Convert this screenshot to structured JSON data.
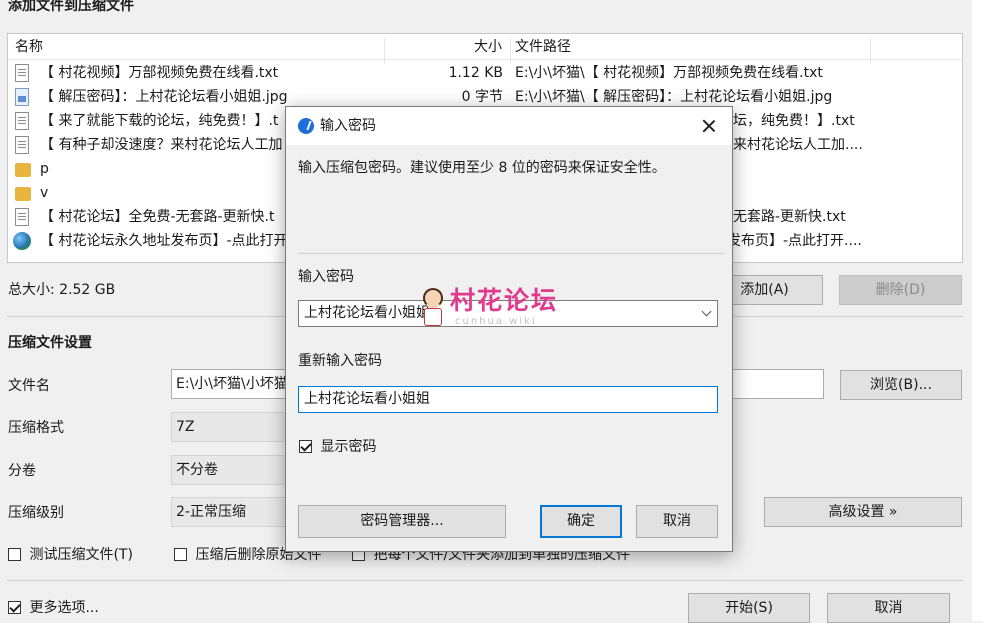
{
  "window": {
    "title": "添加文件到压缩文件"
  },
  "file_list": {
    "headers": {
      "name": "名称",
      "size": "大小",
      "path": "文件路径"
    },
    "rows": [
      {
        "icon": "text-file-icon",
        "name": "【 村花视频】万部视频免费在线看.txt",
        "size": "1.12 KB",
        "path": "E:\\小\\坏猫\\【 村花视频】万部视频免费在线看.txt"
      },
      {
        "icon": "image-file-icon",
        "name": "【 解压密码】：上村花论坛看小姐姐.jpg",
        "size": "0 字节",
        "path": "E:\\小\\坏猫\\【 解压密码】：上村花论坛看小姐姐.jpg"
      },
      {
        "icon": "text-file-icon",
        "name": "【 来了就能下载的论坛，纯免费！】.t",
        "size": "",
        "path": "坛，纯免费！】.txt"
      },
      {
        "icon": "text-file-icon",
        "name": "【 有种子却没速度？来村花论坛人工加",
        "size": "",
        "path": "来村花论坛人工加...."
      },
      {
        "icon": "folder-icon",
        "name": "p",
        "size": "",
        "path": ""
      },
      {
        "icon": "folder-icon",
        "name": "v",
        "size": "",
        "path": ""
      },
      {
        "icon": "text-file-icon",
        "name": "【 村花论坛】全免费-无套路-更新快.t",
        "size": "",
        "path": "无套路-更新快.txt"
      },
      {
        "icon": "globe-icon",
        "name": "【 村花论坛永久地址发布页】-点此打开",
        "size": "",
        "path": "发布页】-点此打开...."
      }
    ]
  },
  "total_size": "总大小: 2.52 GB",
  "buttons": {
    "add": "添加(A)",
    "remove": "删除(D)",
    "browse": "浏览(B)...",
    "advanced": "高级设置 »",
    "start": "开始(S)",
    "cancel": "取消"
  },
  "settings": {
    "section_title": "压缩文件设置",
    "filename_label": "文件名",
    "filename_value": "E:\\小\\坏猫\\小坏猫",
    "format_label": "压缩格式",
    "format_value": "7Z",
    "split_label": "分卷",
    "split_value": "不分卷",
    "level_label": "压缩级别",
    "level_value": "2-正常压缩",
    "test_label": "测试压缩文件(T)",
    "delete_label": "压缩后删除原始文件",
    "each_label": "把每个文件/文件夹添加到单独的压缩文件",
    "more_label": "更多选项..."
  },
  "dialog": {
    "title": "输入密码",
    "description": "输入压缩包密码。建议使用至少 8 位的密码来保证安全性。",
    "password_label": "输入密码",
    "password_value": "上村花论坛看小姐姐",
    "reenter_label": "重新输入密码",
    "reenter_value": "上村花论坛看小姐姐",
    "show_password_label": "显示密码",
    "show_password_checked": true,
    "manager_button": "密码管理器...",
    "ok_button": "确定",
    "cancel_button": "取消"
  },
  "watermark": {
    "text": "村花论坛",
    "subtext": "cunhua.wiki"
  }
}
